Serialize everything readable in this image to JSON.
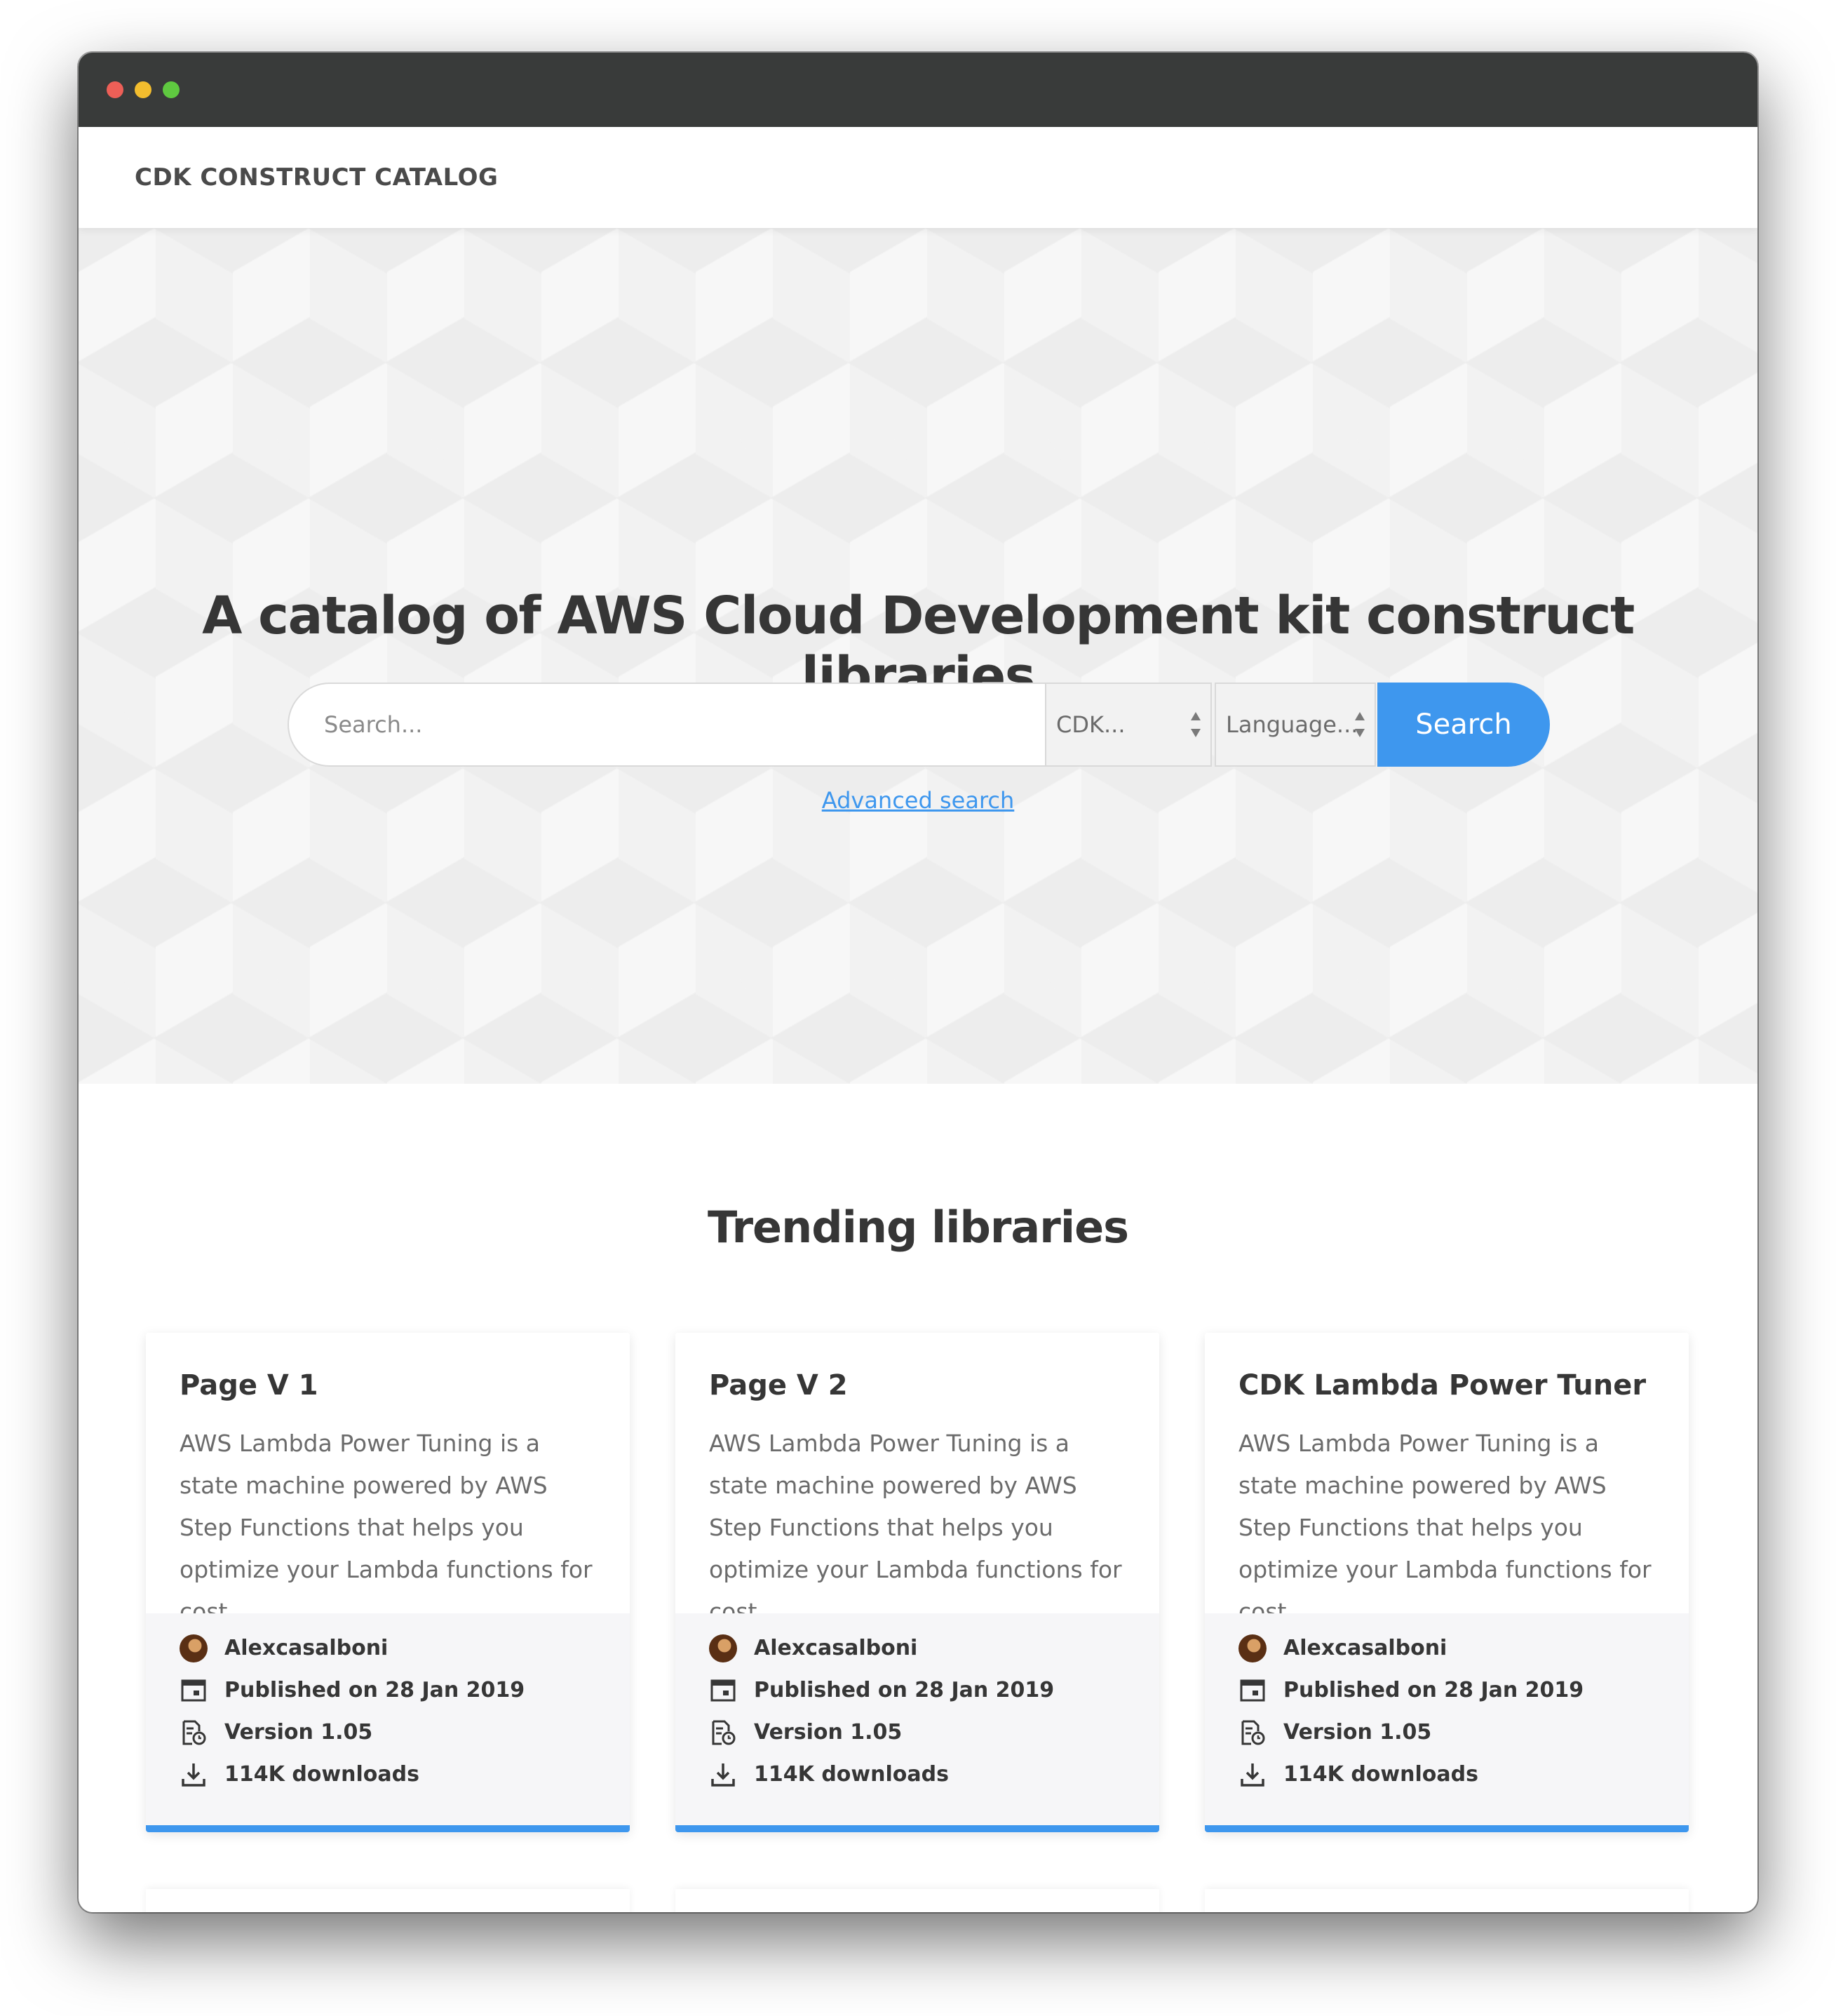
{
  "window": {
    "traffic_lights": [
      "close",
      "minimize",
      "zoom"
    ]
  },
  "navbar": {
    "brand": "CDK CONSTRUCT CATALOG"
  },
  "hero": {
    "title": "A catalog of AWS Cloud Development kit construct libraries",
    "search_placeholder": "Search...",
    "cdk_select": "CDK...",
    "language_select": "Language...",
    "search_button": "Search",
    "advanced_link": "Advanced search"
  },
  "trending": {
    "title": "Trending libraries",
    "cards": [
      {
        "title": "Page V 1",
        "description": "AWS Lambda Power Tuning is a state machine powered by AWS Step Functions that helps you optimize your Lambda functions for cost...",
        "author": "Alexcasalboni",
        "published": "Published on 28 Jan 2019",
        "version": "Version 1.05",
        "downloads": "114K downloads"
      },
      {
        "title": "Page V 2",
        "description": "AWS Lambda Power Tuning is a state machine powered by AWS Step Functions that helps you optimize your Lambda functions for cost...",
        "author": "Alexcasalboni",
        "published": "Published on 28 Jan 2019",
        "version": "Version 1.05",
        "downloads": "114K downloads"
      },
      {
        "title": "CDK Lambda Power Tuner",
        "description": "AWS Lambda Power Tuning is a state machine powered by AWS Step Functions that helps you optimize your Lambda functions for cost...",
        "author": "Alexcasalboni",
        "published": "Published on 28 Jan 2019",
        "version": "Version 1.05",
        "downloads": "114K downloads"
      }
    ]
  },
  "colors": {
    "accent": "#3e97ee",
    "titlebar": "#393b3a",
    "text": "#363636"
  },
  "icons": [
    "avatar",
    "calendar-icon",
    "version-icon",
    "download-icon"
  ]
}
